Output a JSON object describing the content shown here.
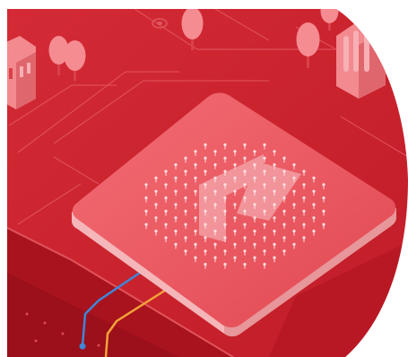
{
  "scene": {
    "palette": {
      "white": "#ffffff",
      "base_red": "#c8202c",
      "mid_red": "#d6303a",
      "light_red": "#e04a52",
      "dark_red": "#a8141f",
      "deep_red": "#8f0f19",
      "pad_top": "#ec5a62",
      "pad_side": "#b91a25",
      "pad_edge_light": "#f7a3a7",
      "tree_pink": "#f58c92",
      "tree_trunk": "#d9414a",
      "building_pink": "#f28a8f",
      "pin_white": "#ffe0e2",
      "route_blue": "#3f86d6",
      "route_orange": "#f4a23a"
    },
    "icons": {
      "central_symbol": "forward-arrow-icon",
      "nodes": "map-pin-icon",
      "trees": "tree-icon",
      "buildings": "building-icon"
    }
  }
}
